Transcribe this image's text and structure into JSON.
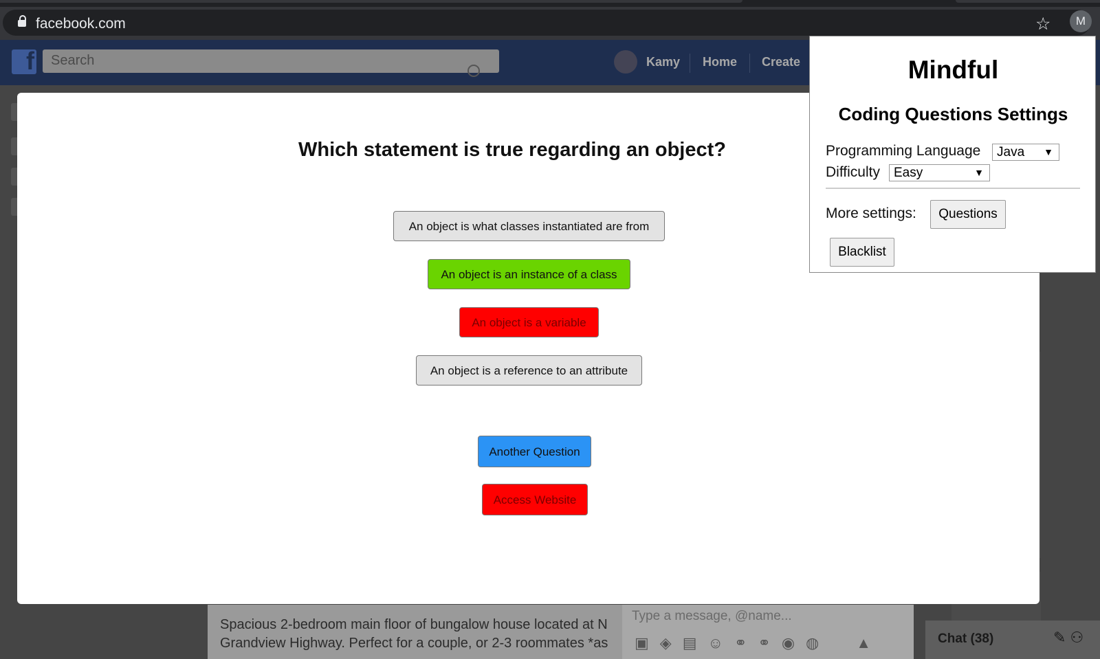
{
  "browser": {
    "url": "facebook.com",
    "profile_initial": "M"
  },
  "facebook": {
    "logo": "f",
    "search_placeholder": "Search",
    "user_name": "Kamy",
    "nav": [
      "Home",
      "Create"
    ],
    "post_text_line1": "Spacious 2-bedroom main floor of bungalow house located at N",
    "post_text_line2": "Grandview Highway. Perfect for a couple, or 2-3 roommates *as",
    "message_placeholder": "Type a message, @name...",
    "chat_label": "Chat (38)"
  },
  "quiz": {
    "question": "Which statement is true regarding an object?",
    "answers": [
      {
        "label": "An object is what classes instantiated are from",
        "state": "neutral"
      },
      {
        "label": "An object is an instance of a class",
        "state": "correct"
      },
      {
        "label": "An object is a variable",
        "state": "wrong"
      },
      {
        "label": "An object is a reference to an attribute",
        "state": "neutral"
      }
    ],
    "another_question_label": "Another Question",
    "access_website_label": "Access Website"
  },
  "popup": {
    "title": "Mindful",
    "subtitle": "Coding Questions Settings",
    "language_label": "Programming Language",
    "language_value": "Java",
    "difficulty_label": "Difficulty",
    "difficulty_value": "Easy",
    "more_settings_label": "More settings:",
    "questions_button": "Questions",
    "blacklist_button": "Blacklist"
  },
  "colors": {
    "correct": "#6ad400",
    "wrong": "#ff0000",
    "primary": "#2b93f5"
  }
}
